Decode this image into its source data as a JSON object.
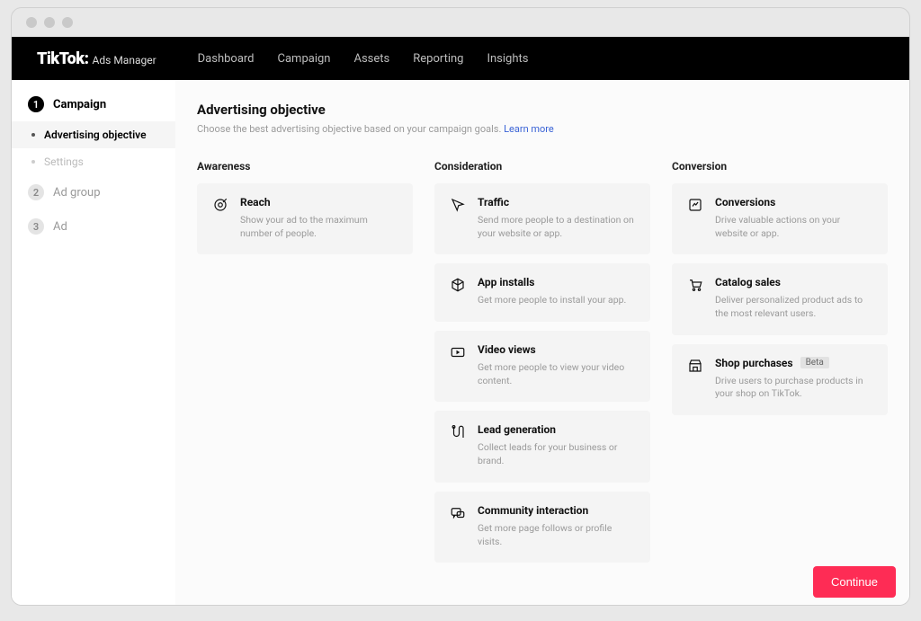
{
  "brand": {
    "logo": "TikTok:",
    "sub": "Ads Manager"
  },
  "nav": [
    "Dashboard",
    "Campaign",
    "Assets",
    "Reporting",
    "Insights"
  ],
  "sidebar": {
    "steps": [
      {
        "num": "1",
        "label": "Campaign",
        "active": true
      },
      {
        "num": "2",
        "label": "Ad group",
        "active": false
      },
      {
        "num": "3",
        "label": "Ad",
        "active": false
      }
    ],
    "subs": [
      {
        "label": "Advertising objective",
        "selected": true
      },
      {
        "label": "Settings",
        "selected": false
      }
    ]
  },
  "page": {
    "title": "Advertising objective",
    "desc": "Choose the best advertising objective based on your campaign goals.",
    "learn": "Learn more"
  },
  "columns": [
    {
      "title": "Awareness",
      "cards": [
        {
          "icon": "target",
          "title": "Reach",
          "desc": "Show your ad to the maximum number of people."
        }
      ]
    },
    {
      "title": "Consideration",
      "cards": [
        {
          "icon": "cursor",
          "title": "Traffic",
          "desc": "Send more people to a destination on your website or app."
        },
        {
          "icon": "box",
          "title": "App installs",
          "desc": "Get more people to install your app."
        },
        {
          "icon": "video",
          "title": "Video views",
          "desc": "Get more people to view your video content."
        },
        {
          "icon": "lead",
          "title": "Lead generation",
          "desc": "Collect leads for your business or brand."
        },
        {
          "icon": "chat",
          "title": "Community interaction",
          "desc": "Get more page follows or profile visits."
        }
      ]
    },
    {
      "title": "Conversion",
      "cards": [
        {
          "icon": "convert",
          "title": "Conversions",
          "desc": "Drive valuable actions on your website or app."
        },
        {
          "icon": "cart",
          "title": "Catalog sales",
          "desc": "Deliver personalized product ads to the most relevant users."
        },
        {
          "icon": "shop",
          "title": "Shop purchases",
          "badge": "Beta",
          "desc": "Drive users to purchase products in your shop on TikTok."
        }
      ]
    }
  ],
  "footer": {
    "continue": "Continue"
  }
}
